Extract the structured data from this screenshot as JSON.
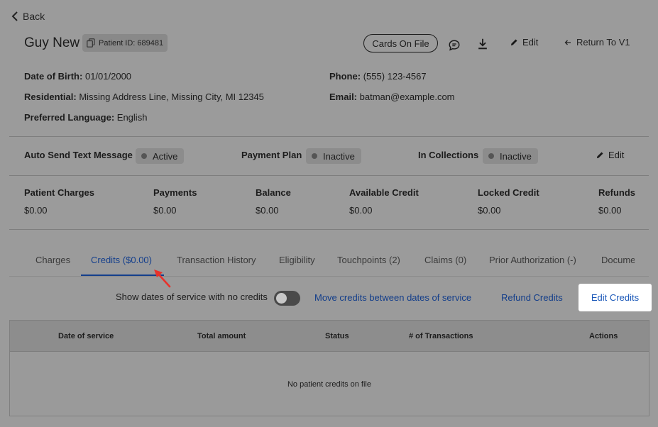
{
  "nav": {
    "back_label": "Back"
  },
  "patient": {
    "name": "Guy New",
    "id_label": "Patient ID: 689481"
  },
  "header_actions": {
    "cards_on_file": "Cards On File",
    "edit": "Edit",
    "return_v1": "Return To V1"
  },
  "details": {
    "dob_label": "Date of Birth:",
    "dob_value": "01/01/2000",
    "residential_label": "Residential:",
    "residential_value": "Missing Address Line, Missing City, MI 12345",
    "language_label": "Preferred Language:",
    "language_value": "English",
    "phone_label": "Phone:",
    "phone_value": "(555) 123-4567",
    "email_label": "Email:",
    "email_value": "batman@example.com"
  },
  "statuses": {
    "auto_text_label": "Auto Send Text Message",
    "auto_text_value": "Active",
    "payment_plan_label": "Payment Plan",
    "payment_plan_value": "Inactive",
    "collections_label": "In Collections",
    "collections_value": "Inactive",
    "edit_label": "Edit"
  },
  "summary": [
    {
      "label": "Patient Charges",
      "value": "$0.00"
    },
    {
      "label": "Payments",
      "value": "$0.00"
    },
    {
      "label": "Balance",
      "value": "$0.00"
    },
    {
      "label": "Available Credit",
      "value": "$0.00"
    },
    {
      "label": "Locked Credit",
      "value": "$0.00"
    },
    {
      "label": "Refunds",
      "value": "$0.00"
    }
  ],
  "tabs": [
    {
      "label": "Charges"
    },
    {
      "label": "Credits ($0.00)"
    },
    {
      "label": "Transaction History"
    },
    {
      "label": "Eligibility"
    },
    {
      "label": "Touchpoints (2)"
    },
    {
      "label": "Claims (0)"
    },
    {
      "label": "Prior Authorization (-)"
    },
    {
      "label": "Docume"
    }
  ],
  "credits_toolbar": {
    "toggle_label": "Show dates of service with no credits",
    "move_credits": "Move credits between dates of service",
    "refund_credits": "Refund Credits",
    "edit_credits": "Edit Credits"
  },
  "table": {
    "columns": [
      "Date of service",
      "Total amount",
      "Status",
      "# of Transactions",
      "Actions"
    ],
    "empty_message": "No patient credits on file"
  },
  "colors": {
    "accent": "#143f8c",
    "link": "#123d8a",
    "annotation_arrow": "#e8322b"
  }
}
